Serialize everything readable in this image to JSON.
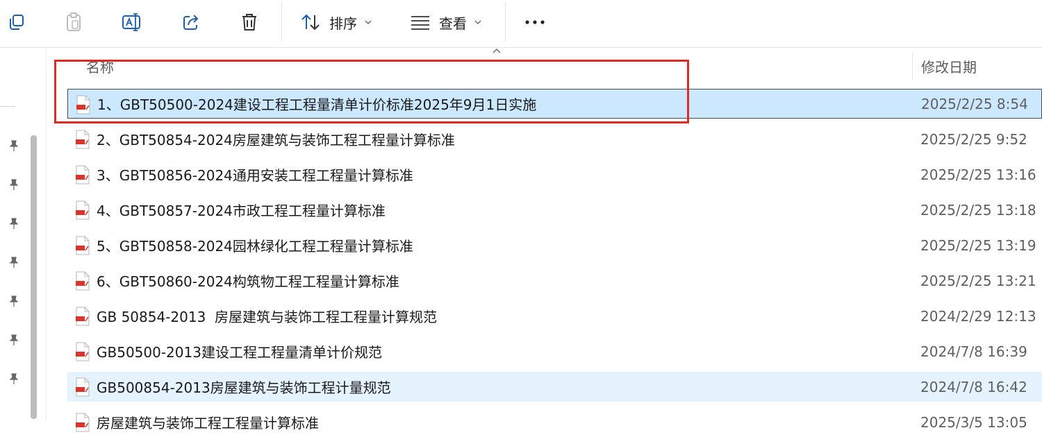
{
  "toolbar": {
    "copy_icon": "copy-icon",
    "paste_icon": "paste-icon",
    "rename_icon": "rename-icon",
    "share_icon": "share-icon",
    "delete_icon": "trash-icon",
    "sort_label": "排序",
    "view_label": "查看",
    "more_icon": "more-icon"
  },
  "columns": {
    "name": "名称",
    "modified": "修改日期"
  },
  "files": [
    {
      "name": "1、GBT50500-2024建设工程工程量清单计价标准2025年9月1日实施",
      "modified": "2025/2/25 8:54"
    },
    {
      "name": "2、GBT50854-2024房屋建筑与装饰工程工程量计算标准",
      "modified": "2025/2/25 9:52"
    },
    {
      "name": "3、GBT50856-2024通用安装工程工程量计算标准",
      "modified": "2025/2/25 13:16"
    },
    {
      "name": "4、GBT50857-2024市政工程工程量计算标准",
      "modified": "2025/2/25 13:18"
    },
    {
      "name": "5、GBT50858-2024园林绿化工程工程量计算标准",
      "modified": "2025/2/25 13:19"
    },
    {
      "name": "6、GBT50860-2024构筑物工程工程量计算标准",
      "modified": "2025/2/25 13:21"
    },
    {
      "name": "GB 50854-2013  房屋建筑与装饰工程工程量计算规范",
      "modified": "2024/2/29 12:13"
    },
    {
      "name": "GB50500-2013建设工程工程量清单计价规范",
      "modified": "2024/7/8 16:39"
    },
    {
      "name": "GB500854-2013房屋建筑与装饰工程计量规范",
      "modified": "2024/7/8 16:42"
    },
    {
      "name": "房屋建筑与装饰工程工程量计算标准",
      "modified": "2025/3/5 13:05"
    }
  ],
  "colors": {
    "selected_bg": "#cce8ff",
    "hover_bg": "#e5f3ff",
    "highlight": "#e02a24"
  }
}
